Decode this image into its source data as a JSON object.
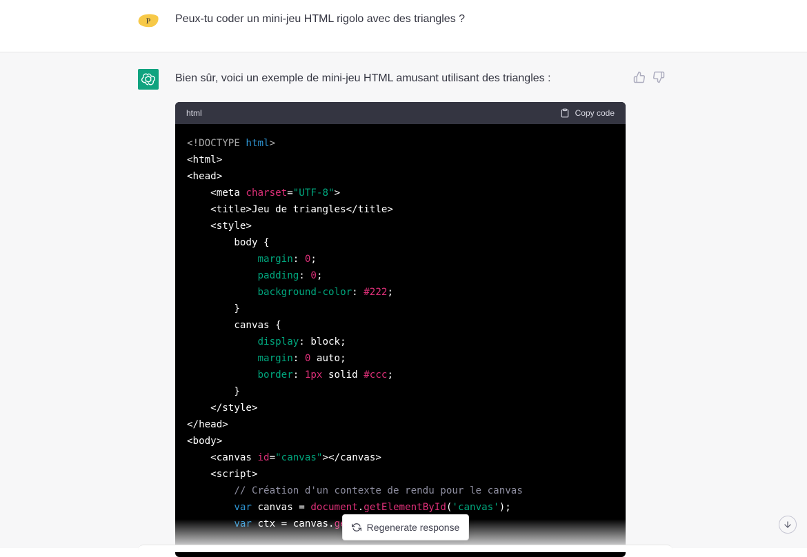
{
  "user_message": {
    "avatar_letter": "P",
    "text": "Peux-tu coder un mini-jeu HTML rigolo avec des triangles ?"
  },
  "assistant_message": {
    "avatar_icon": "openai-logo-icon",
    "text": "Bien sûr, voici un exemple de mini-jeu HTML amusant utilisant des triangles :",
    "feedback": {
      "like_icon": "thumbs-up-icon",
      "dislike_icon": "thumbs-down-icon"
    }
  },
  "code_block": {
    "language": "html",
    "copy_label": "Copy code",
    "colors": {
      "default": "#ffffff",
      "doctype": "#a9a9a9",
      "keyword_blue": "#2e95d3",
      "attr": "#df3079",
      "string": "#00a67d",
      "comment": "#8e8ea0"
    },
    "lines": [
      [
        {
          "t": "<!DOCTYPE ",
          "c": "doctype"
        },
        {
          "t": "html",
          "c": "keyword_blue"
        },
        {
          "t": ">",
          "c": "doctype"
        }
      ],
      [
        {
          "t": "<html>",
          "c": "default"
        }
      ],
      [
        {
          "t": "<head>",
          "c": "default"
        }
      ],
      [
        {
          "t": "    <meta ",
          "c": "default"
        },
        {
          "t": "charset",
          "c": "attr"
        },
        {
          "t": "=",
          "c": "default"
        },
        {
          "t": "\"UTF-8\"",
          "c": "string"
        },
        {
          "t": ">",
          "c": "default"
        }
      ],
      [
        {
          "t": "    <title>Jeu de triangles</title>",
          "c": "default"
        }
      ],
      [
        {
          "t": "    <style>",
          "c": "default"
        }
      ],
      [
        {
          "t": "        body {",
          "c": "default"
        }
      ],
      [
        {
          "t": "            ",
          "c": "default"
        },
        {
          "t": "margin",
          "c": "string"
        },
        {
          "t": ": ",
          "c": "default"
        },
        {
          "t": "0",
          "c": "attr"
        },
        {
          "t": ";",
          "c": "default"
        }
      ],
      [
        {
          "t": "            ",
          "c": "default"
        },
        {
          "t": "padding",
          "c": "string"
        },
        {
          "t": ": ",
          "c": "default"
        },
        {
          "t": "0",
          "c": "attr"
        },
        {
          "t": ";",
          "c": "default"
        }
      ],
      [
        {
          "t": "            ",
          "c": "default"
        },
        {
          "t": "background-color",
          "c": "string"
        },
        {
          "t": ": ",
          "c": "default"
        },
        {
          "t": "#222",
          "c": "attr"
        },
        {
          "t": ";",
          "c": "default"
        }
      ],
      [
        {
          "t": "        }",
          "c": "default"
        }
      ],
      [
        {
          "t": "        canvas {",
          "c": "default"
        }
      ],
      [
        {
          "t": "            ",
          "c": "default"
        },
        {
          "t": "display",
          "c": "string"
        },
        {
          "t": ": block;",
          "c": "default"
        }
      ],
      [
        {
          "t": "            ",
          "c": "default"
        },
        {
          "t": "margin",
          "c": "string"
        },
        {
          "t": ": ",
          "c": "default"
        },
        {
          "t": "0",
          "c": "attr"
        },
        {
          "t": " auto;",
          "c": "default"
        }
      ],
      [
        {
          "t": "            ",
          "c": "default"
        },
        {
          "t": "border",
          "c": "string"
        },
        {
          "t": ": ",
          "c": "default"
        },
        {
          "t": "1px",
          "c": "attr"
        },
        {
          "t": " solid ",
          "c": "default"
        },
        {
          "t": "#ccc",
          "c": "attr"
        },
        {
          "t": ";",
          "c": "default"
        }
      ],
      [
        {
          "t": "        }",
          "c": "default"
        }
      ],
      [
        {
          "t": "    </style>",
          "c": "default"
        }
      ],
      [
        {
          "t": "</head>",
          "c": "default"
        }
      ],
      [
        {
          "t": "<body>",
          "c": "default"
        }
      ],
      [
        {
          "t": "    <canvas ",
          "c": "default"
        },
        {
          "t": "id",
          "c": "attr"
        },
        {
          "t": "=",
          "c": "default"
        },
        {
          "t": "\"canvas\"",
          "c": "string"
        },
        {
          "t": "></canvas>",
          "c": "default"
        }
      ],
      [
        {
          "t": "    <script>",
          "c": "default"
        }
      ],
      [
        {
          "t": "        // Création d'un contexte de rendu pour le canvas",
          "c": "comment"
        }
      ],
      [
        {
          "t": "        ",
          "c": "default"
        },
        {
          "t": "var",
          "c": "keyword_blue"
        },
        {
          "t": " canvas = ",
          "c": "default"
        },
        {
          "t": "document",
          "c": "attr"
        },
        {
          "t": ".",
          "c": "default"
        },
        {
          "t": "getElementById",
          "c": "attr"
        },
        {
          "t": "(",
          "c": "default"
        },
        {
          "t": "'canvas'",
          "c": "string"
        },
        {
          "t": ");",
          "c": "default"
        }
      ],
      [
        {
          "t": "        ",
          "c": "default"
        },
        {
          "t": "var",
          "c": "keyword_blue"
        },
        {
          "t": " ctx = canvas.",
          "c": "default"
        },
        {
          "t": "ge",
          "c": "attr"
        }
      ]
    ]
  },
  "regenerate_label": "Regenerate response",
  "regenerate_icon": "refresh-icon",
  "scroll_icon": "arrow-down-icon"
}
